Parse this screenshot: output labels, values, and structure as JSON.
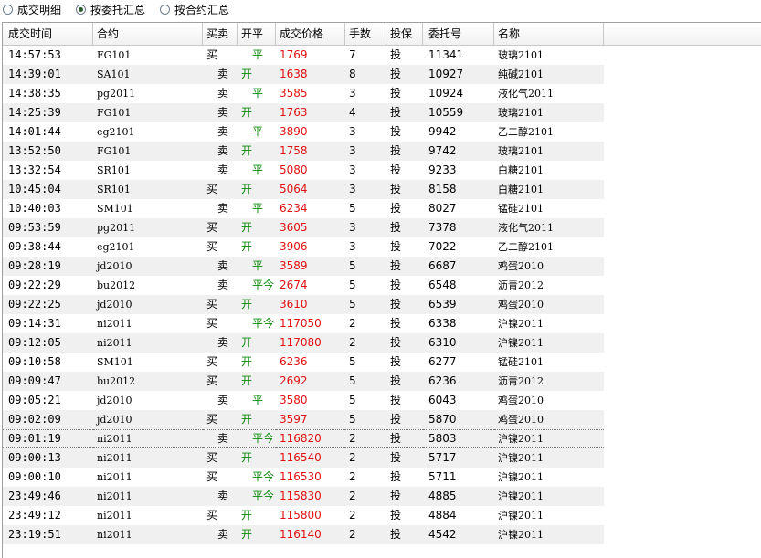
{
  "toolbar": {
    "options": [
      {
        "label": "成交明细",
        "checked": false
      },
      {
        "label": "按委托汇总",
        "checked": true
      },
      {
        "label": "按合约汇总",
        "checked": false
      }
    ]
  },
  "table": {
    "columns": [
      "成交时间",
      "合约",
      "买卖",
      "开平",
      "成交价格",
      "手数",
      "投保",
      "委托号",
      "名称"
    ],
    "rows": [
      [
        "14:57:53",
        "FG101",
        "买",
        "平",
        "1769",
        "7",
        "投",
        "11341",
        "玻璃2101"
      ],
      [
        "14:39:01",
        "SA101",
        "卖",
        "开",
        "1638",
        "8",
        "投",
        "10927",
        "纯碱2101"
      ],
      [
        "14:38:35",
        "pg2011",
        "卖",
        "平",
        "3585",
        "3",
        "投",
        "10924",
        "液化气2011"
      ],
      [
        "14:25:39",
        "FG101",
        "卖",
        "开",
        "1763",
        "4",
        "投",
        "10559",
        "玻璃2101"
      ],
      [
        "14:01:44",
        "eg2101",
        "卖",
        "平",
        "3890",
        "3",
        "投",
        "9942",
        "乙二醇2101"
      ],
      [
        "13:52:50",
        "FG101",
        "卖",
        "开",
        "1758",
        "3",
        "投",
        "9742",
        "玻璃2101"
      ],
      [
        "13:32:54",
        "SR101",
        "卖",
        "平",
        "5080",
        "3",
        "投",
        "9233",
        "白糖2101"
      ],
      [
        "10:45:04",
        "SR101",
        "买",
        "开",
        "5064",
        "3",
        "投",
        "8158",
        "白糖2101"
      ],
      [
        "10:40:03",
        "SM101",
        "卖",
        "平",
        "6234",
        "5",
        "投",
        "8027",
        "锰硅2101"
      ],
      [
        "09:53:59",
        "pg2011",
        "买",
        "开",
        "3605",
        "3",
        "投",
        "7378",
        "液化气2011"
      ],
      [
        "09:38:44",
        "eg2101",
        "买",
        "开",
        "3906",
        "3",
        "投",
        "7022",
        "乙二醇2101"
      ],
      [
        "09:28:19",
        "jd2010",
        "卖",
        "平",
        "3589",
        "5",
        "投",
        "6687",
        "鸡蛋2010"
      ],
      [
        "09:22:29",
        "bu2012",
        "卖",
        "平今",
        "2674",
        "5",
        "投",
        "6548",
        "沥青2012"
      ],
      [
        "09:22:25",
        "jd2010",
        "买",
        "开",
        "3610",
        "5",
        "投",
        "6539",
        "鸡蛋2010"
      ],
      [
        "09:14:31",
        "ni2011",
        "买",
        "平今",
        "117050",
        "2",
        "投",
        "6338",
        "沪镍2011"
      ],
      [
        "09:12:05",
        "ni2011",
        "卖",
        "开",
        "117080",
        "2",
        "投",
        "6310",
        "沪镍2011"
      ],
      [
        "09:10:58",
        "SM101",
        "买",
        "开",
        "6236",
        "5",
        "投",
        "6277",
        "锰硅2101"
      ],
      [
        "09:09:47",
        "bu2012",
        "买",
        "开",
        "2692",
        "5",
        "投",
        "6236",
        "沥青2012"
      ],
      [
        "09:05:21",
        "jd2010",
        "卖",
        "平",
        "3580",
        "5",
        "投",
        "6043",
        "鸡蛋2010"
      ],
      [
        "09:02:09",
        "jd2010",
        "买",
        "开",
        "3597",
        "5",
        "投",
        "5870",
        "鸡蛋2010"
      ],
      [
        "09:01:19",
        "ni2011",
        "卖",
        "平今",
        "116820",
        "2",
        "投",
        "5803",
        "沪镍2011"
      ],
      [
        "09:00:13",
        "ni2011",
        "买",
        "开",
        "116540",
        "2",
        "投",
        "5717",
        "沪镍2011"
      ],
      [
        "09:00:10",
        "ni2011",
        "买",
        "平今",
        "116530",
        "2",
        "投",
        "5711",
        "沪镍2011"
      ],
      [
        "23:49:46",
        "ni2011",
        "卖",
        "平今",
        "115830",
        "2",
        "投",
        "4885",
        "沪镍2011"
      ],
      [
        "23:49:12",
        "ni2011",
        "买",
        "开",
        "115800",
        "2",
        "投",
        "4884",
        "沪镍2011"
      ],
      [
        "23:19:51",
        "ni2011",
        "卖",
        "开",
        "116140",
        "2",
        "投",
        "4542",
        "沪镍2011"
      ]
    ],
    "selected_row": 20
  },
  "colors": {
    "price": "#e01010",
    "open_close": "#0a8a0a",
    "row_alt": "#f0f0f0"
  }
}
